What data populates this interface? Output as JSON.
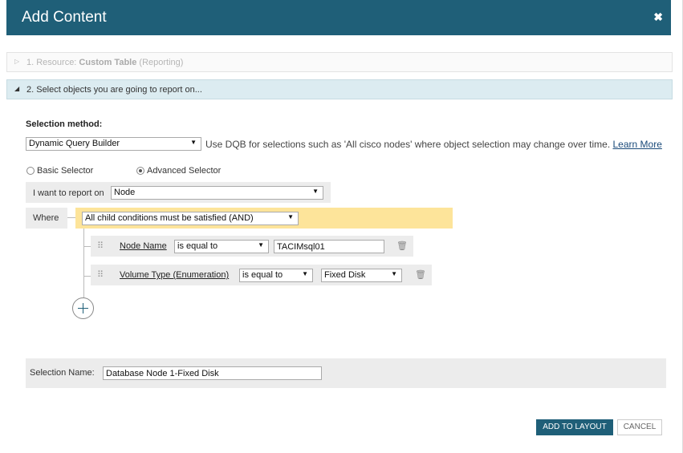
{
  "dialog": {
    "title": "Add Content",
    "close_icon": "close-icon"
  },
  "steps": [
    {
      "prefix": "1. Resource: ",
      "name": "Custom Table",
      "suffix": " (Reporting)"
    },
    {
      "label": "2. Select objects you are going to report on..."
    }
  ],
  "selection_method": {
    "label": "Selection method:",
    "value": "Dynamic Query Builder",
    "help_text": "Use DQB for selections such as 'All cisco nodes' where object selection may change over time.",
    "learn_more": "Learn More"
  },
  "selector_modes": [
    {
      "label": "Basic Selector",
      "selected": false
    },
    {
      "label": "Advanced Selector",
      "selected": true
    }
  ],
  "report_on": {
    "label": "I want to report on",
    "value": "Node"
  },
  "where": {
    "label": "Where",
    "logic": "All child conditions must be satisfied (AND)"
  },
  "conditions": [
    {
      "field": "Node Name",
      "operator": "is equal to",
      "value": "TACIMsql01"
    },
    {
      "field": "Volume Type (Enumeration)",
      "operator": "is equal to",
      "value": "Fixed Disk"
    }
  ],
  "selection_name": {
    "label": "Selection Name:",
    "value": "Database Node 1-Fixed Disk"
  },
  "footer": {
    "add_label": "ADD TO LAYOUT",
    "cancel_label": "CANCEL"
  },
  "colors": {
    "titlebar": "#1f5f78",
    "condition_bar": "#fde49a",
    "active_step": "#dcecf1"
  }
}
